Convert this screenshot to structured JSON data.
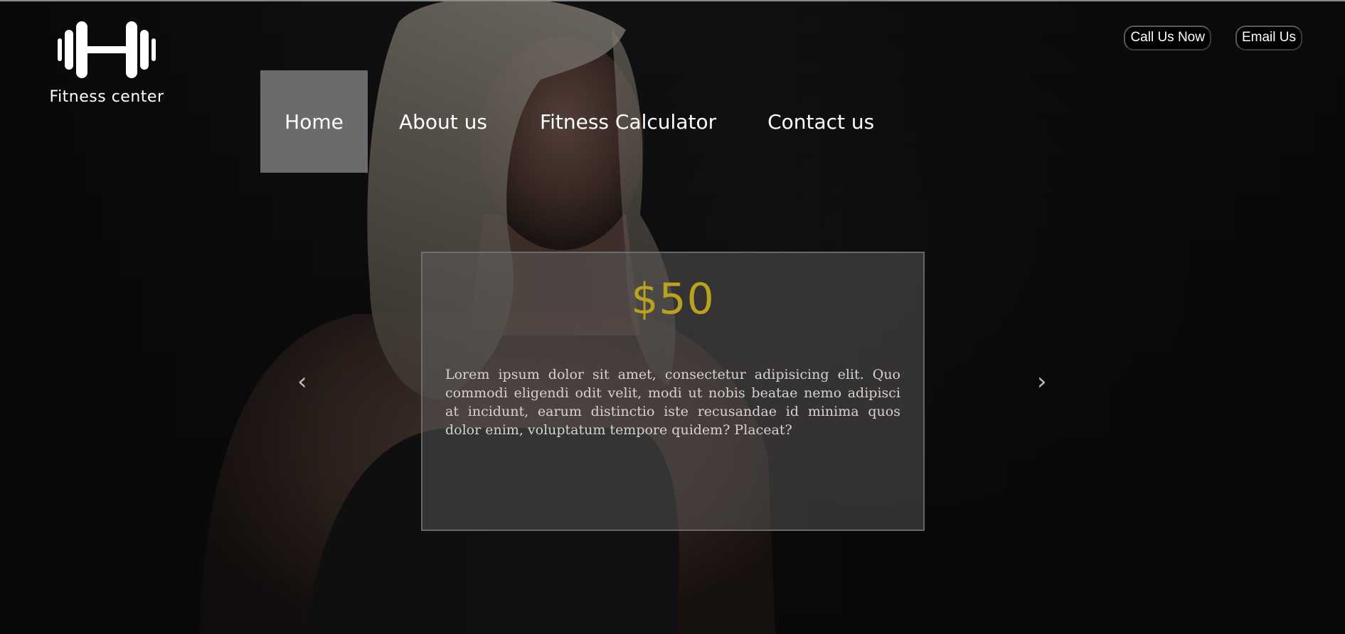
{
  "brand": {
    "logo_icon": "dumbbell-icon",
    "name": "Fitness center"
  },
  "nav": {
    "items": [
      {
        "label": "Home",
        "active": true
      },
      {
        "label": "About us",
        "active": false
      },
      {
        "label": "Fitness Calculator",
        "active": false
      },
      {
        "label": "Contact us",
        "active": false
      }
    ]
  },
  "top_buttons": {
    "call": "Call Us Now",
    "email": "Email Us"
  },
  "slider": {
    "price": "$50",
    "text": "Lorem ipsum dolor sit amet, consectetur adipisicing elit. Quo commodi eligendi odit velit, modi ut nobis beatae nemo adipisci at incidunt, earum distinctio iste recusandae id minima quos dolor enim, voluptatum tempore quidem? Placeat?",
    "prev_glyph": "‹",
    "next_glyph": "›",
    "prev_icon": "chevron-left-icon",
    "next_icon": "chevron-right-icon"
  },
  "colors": {
    "price": "#b8a220",
    "nav_active_bg": "#6b6b6b",
    "background": "#141313"
  }
}
